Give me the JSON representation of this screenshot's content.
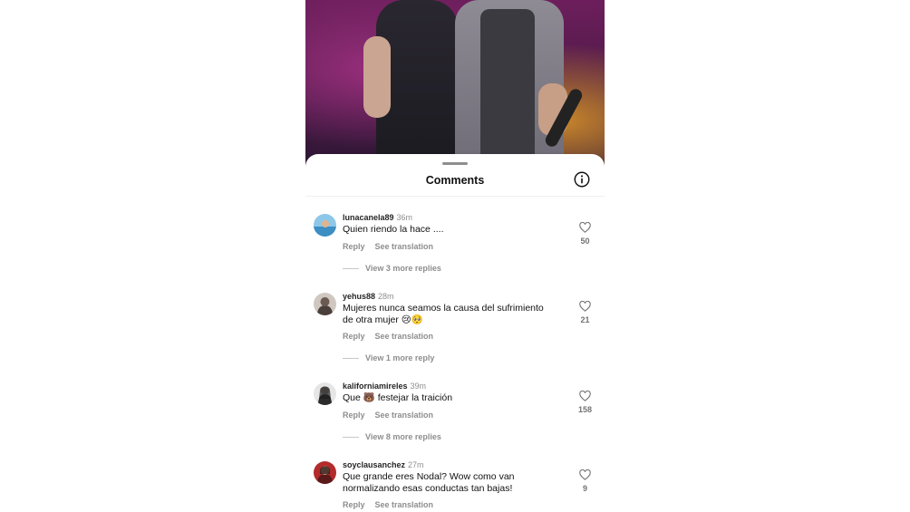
{
  "sheet": {
    "title": "Comments"
  },
  "comments": [
    {
      "username": "lunacanela89",
      "time": "36m",
      "text": "Quien riendo la hace ....",
      "reply_label": "Reply",
      "translate_label": "See translation",
      "replies_label": "View 3 more replies",
      "likes": "50"
    },
    {
      "username": "yehus88",
      "time": "28m",
      "text": "Mujeres nunca seamos la causa del sufrimiento de otra mujer 😢🥺",
      "reply_label": "Reply",
      "translate_label": "See translation",
      "replies_label": "View 1 more reply",
      "likes": "21"
    },
    {
      "username": "kaliforniamireles",
      "time": "39m",
      "text": "Que 🐻 festejar la traición",
      "reply_label": "Reply",
      "translate_label": "See translation",
      "replies_label": "View 8 more replies",
      "likes": "158"
    },
    {
      "username": "soyclausanchez",
      "time": "27m",
      "text": "Que grande eres Nodal? Wow como van normalizando esas conductas tan bajas!",
      "reply_label": "Reply",
      "translate_label": "See translation",
      "likes": "9"
    }
  ],
  "colors": {
    "muted": "#8e8e8e",
    "text": "#111111"
  },
  "icons": {
    "info": "info-circle-icon",
    "like": "heart-outline-icon"
  }
}
